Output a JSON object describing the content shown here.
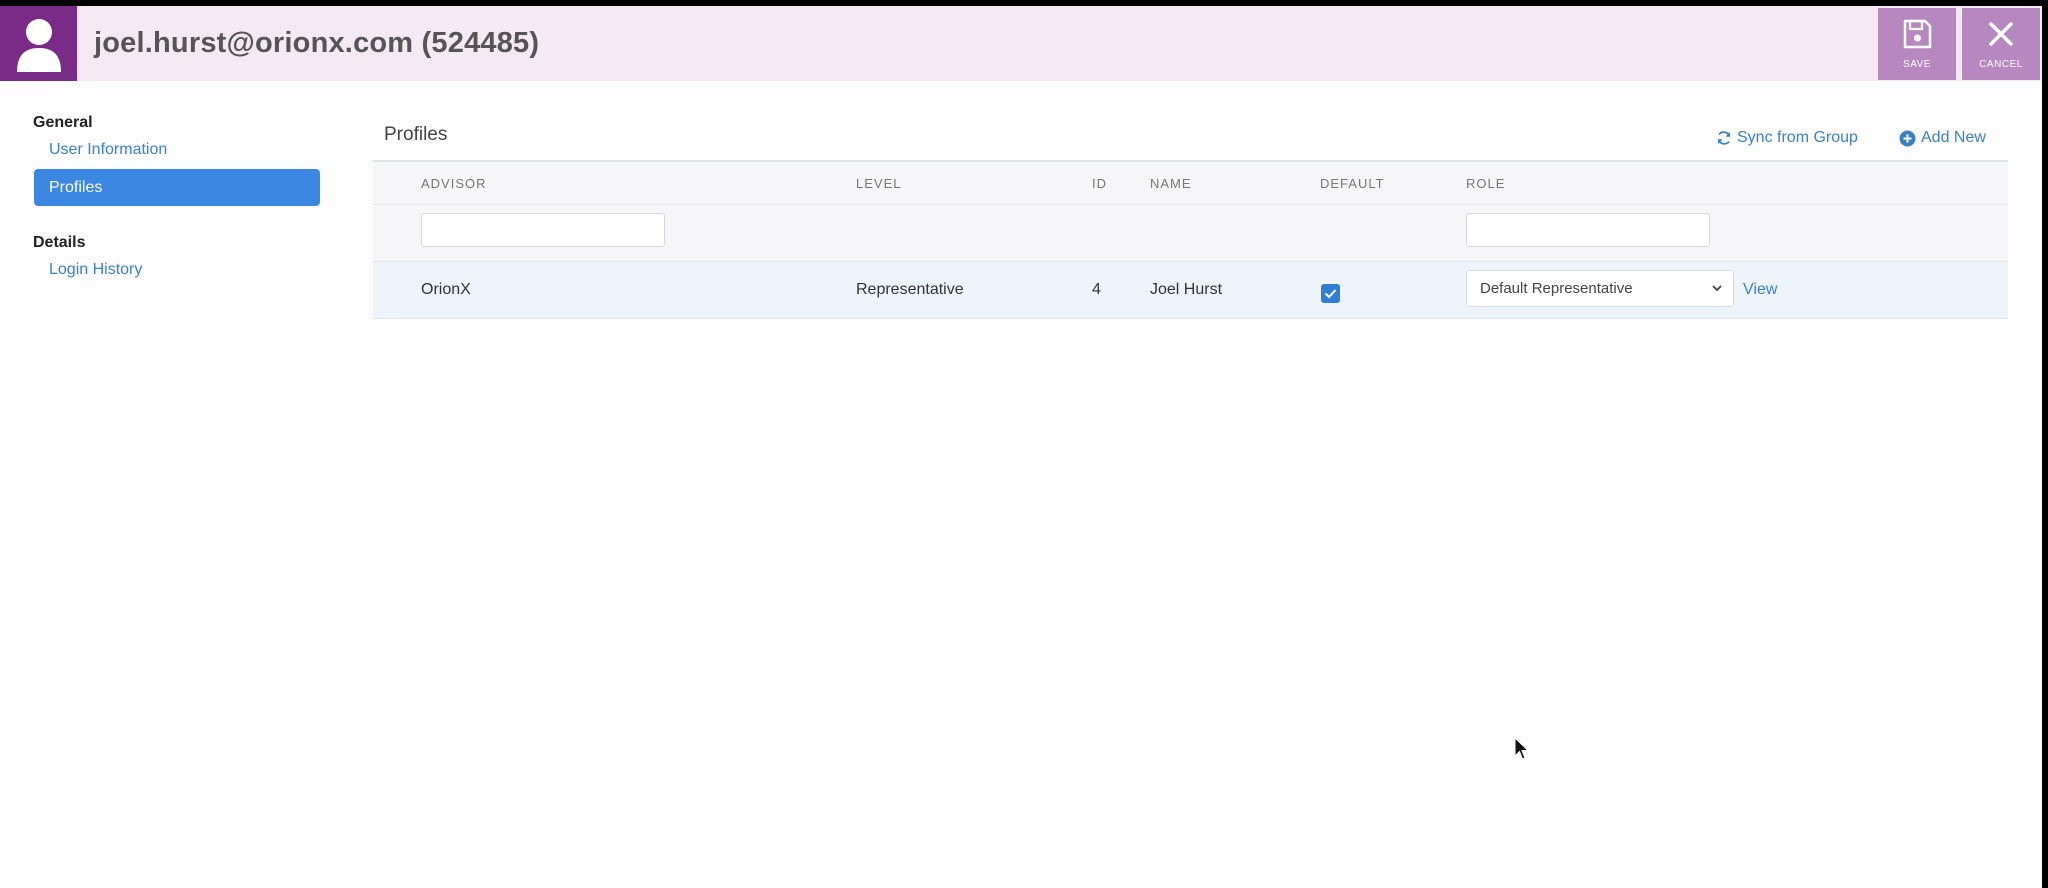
{
  "header": {
    "title": "joel.hurst@orionx.com (524485)",
    "save_label": "SAVE",
    "cancel_label": "CANCEL",
    "accent": "#7a2a87",
    "button_color": "#b787bf"
  },
  "sidebar": {
    "sections": [
      {
        "title": "General",
        "items": [
          "User Information",
          "Profiles"
        ]
      },
      {
        "title": "Details",
        "items": [
          "Login History"
        ]
      }
    ],
    "active_item": "Profiles"
  },
  "main": {
    "title": "Profiles",
    "sync_label": "Sync from Group",
    "add_new_label": "Add New",
    "columns": [
      "ADVISOR",
      "LEVEL",
      "ID",
      "NAME",
      "DEFAULT",
      "ROLE"
    ],
    "filters": {
      "advisor": "",
      "role": ""
    },
    "rows": [
      {
        "advisor": "OrionX",
        "level": "Representative",
        "id": "4",
        "name": "Joel Hurst",
        "default": true,
        "role": "Default Representative",
        "view_label": "View"
      }
    ]
  }
}
